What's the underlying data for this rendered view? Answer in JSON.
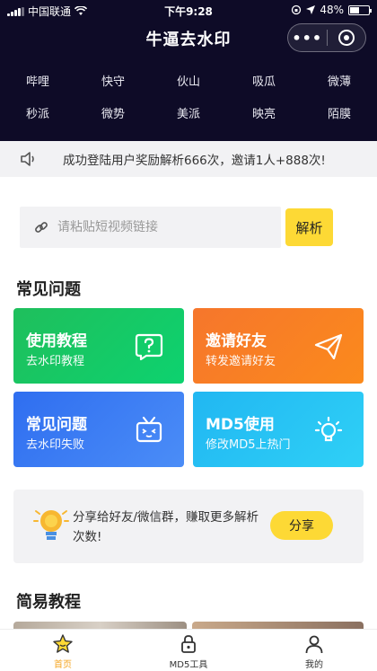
{
  "status_bar": {
    "carrier": "中国联通",
    "time": "下午9:28",
    "battery": "48%",
    "battery_level": 0.48
  },
  "header": {
    "title": "牛逼去水印",
    "more_glyph": "•••"
  },
  "platforms": [
    "哔哩",
    "快守",
    "伙山",
    "吸瓜",
    "微薄",
    "秒派",
    "微势",
    "美派",
    "映亮",
    "陌膜"
  ],
  "notice": {
    "text": "成功登陆用户奖励解析666次，邀请1人+888次!"
  },
  "search": {
    "placeholder": "请粘贴短视频链接",
    "value": "",
    "button": "解析"
  },
  "faq": {
    "title": "常见问题",
    "cards": [
      {
        "title": "使用教程",
        "subtitle": "去水印教程",
        "icon": "question-bubble-icon"
      },
      {
        "title": "邀请好友",
        "subtitle": "转发邀请好友",
        "icon": "paper-plane-icon"
      },
      {
        "title": "常见问题",
        "subtitle": "去水印失败",
        "icon": "tv-face-icon"
      },
      {
        "title": "MD5使用",
        "subtitle": "修改MD5上热门",
        "icon": "lightbulb-icon"
      }
    ]
  },
  "share": {
    "text": "分享给好友/微信群，赚取更多解析次数!",
    "button": "分享"
  },
  "tutorial": {
    "title": "简易教程"
  },
  "tabbar": [
    {
      "label": "首页",
      "icon": "star-icon",
      "active": true
    },
    {
      "label": "MD5工具",
      "icon": "lock-icon",
      "active": false
    },
    {
      "label": "我的",
      "icon": "user-icon",
      "active": false
    }
  ],
  "colors": {
    "header_bg": "#0e0b27",
    "accent_yellow": "#fdd935",
    "active_tab": "#f5a623"
  }
}
